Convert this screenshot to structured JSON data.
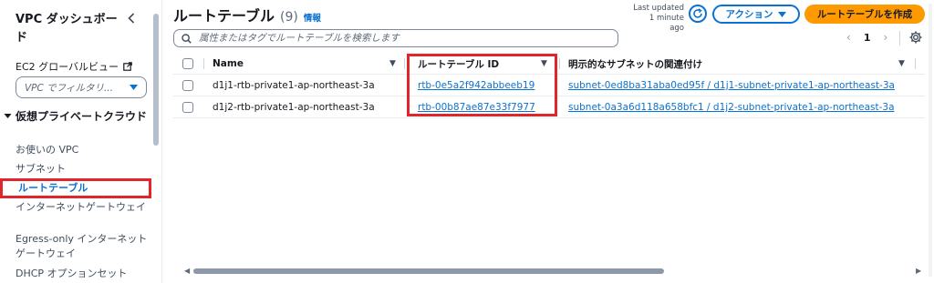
{
  "sidebar": {
    "title": "VPC ダッシュボード",
    "ec2_global_view": "EC2 グローバルビュー",
    "filter_placeholder": "VPC でフィルタリ...",
    "section_title": "仮想プライベートクラウド",
    "items": [
      {
        "label": "お使いの VPC"
      },
      {
        "label": "サブネット"
      },
      {
        "label": "ルートテーブル"
      },
      {
        "label": "インターネットゲートウェイ"
      },
      {
        "label": "Egress-only インターネットゲートウェイ"
      },
      {
        "label": "DHCP オプションセット"
      }
    ]
  },
  "header": {
    "title": "ルートテーブル",
    "count": "(9)",
    "info": "情報",
    "last_updated_label": "Last updated",
    "last_updated_value": "1 minute ago",
    "actions_label": "アクション",
    "create_label": "ルートテーブルを作成"
  },
  "search": {
    "placeholder": "属性またはタグでルートテーブルを検索します"
  },
  "pagination": {
    "current_page": "1"
  },
  "table": {
    "columns": [
      "Name",
      "ルートテーブル ID",
      "明示的なサブネットの関連付け"
    ],
    "rows": [
      {
        "name": "d1j1-rtb-private1-ap-northeast-3a",
        "route_table_id": "rtb-0e5a2f942abbeeb19",
        "subnet_association": "subnet-0ed8ba31aba0ed95f / d1j1-subnet-private1-ap-northeast-3a"
      },
      {
        "name": "d1j2-rtb-private1-ap-northeast-3a",
        "route_table_id": "rtb-00b87ae87e33f7977",
        "subnet_association": "subnet-0a3a6d118a658bfc1 / d1j2-subnet-private1-ap-northeast-3a"
      }
    ]
  },
  "colors": {
    "link": "#0972d3",
    "primary_button": "#ff9900",
    "highlight": "#e0262b"
  },
  "icons": [
    "chevron-left-icon",
    "external-link-icon",
    "caret-down-icon",
    "search-icon",
    "refresh-icon",
    "settings-icon"
  ]
}
